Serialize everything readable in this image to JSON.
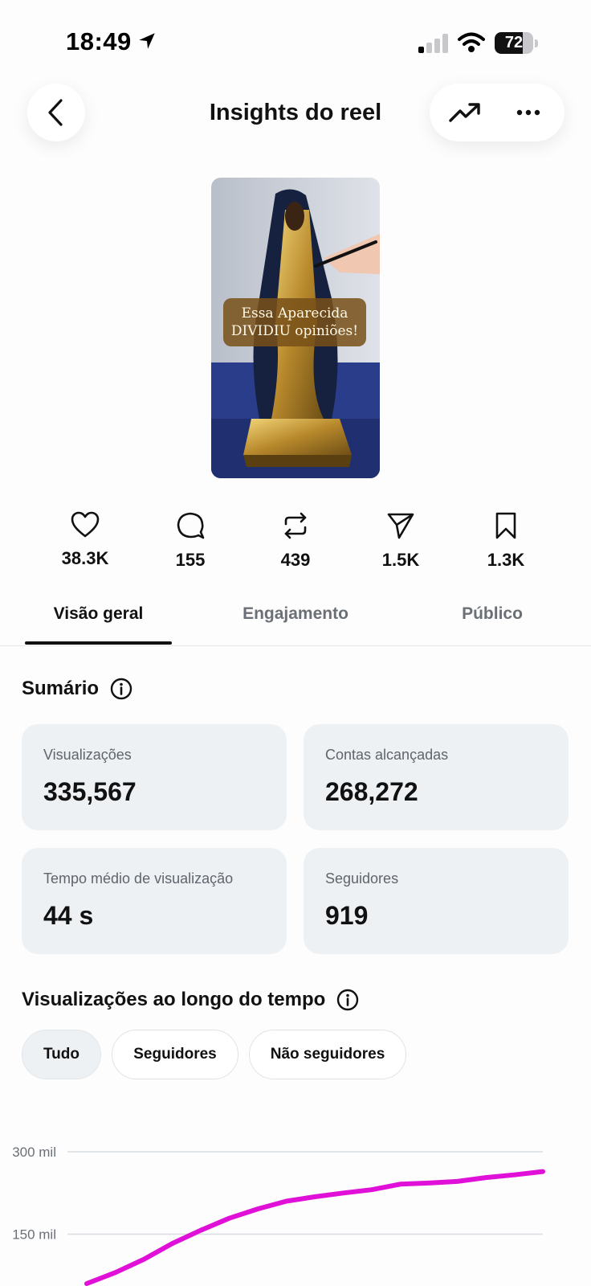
{
  "status_bar": {
    "time": "18:49",
    "battery": "72"
  },
  "header": {
    "title": "Insights do reel"
  },
  "thumbnail": {
    "caption_line1": "Essa Aparecida",
    "caption_line2": "DIVIDIU opiniões!"
  },
  "stats": {
    "likes": "38.3K",
    "comments": "155",
    "reposts": "439",
    "shares": "1.5K",
    "saves": "1.3K"
  },
  "tabs": [
    "Visão geral",
    "Engajamento",
    "Público"
  ],
  "summary": {
    "title": "Sumário",
    "cards": [
      {
        "label": "Visualizações",
        "value": "335,567"
      },
      {
        "label": "Contas alcançadas",
        "value": "268,272"
      },
      {
        "label": "Tempo médio de visualização",
        "value": "44 s"
      },
      {
        "label": "Seguidores",
        "value": "919"
      }
    ]
  },
  "views_over_time": {
    "title": "Visualizações ao longo do tempo",
    "filters": [
      "Tudo",
      "Seguidores",
      "Não seguidores"
    ],
    "selected_filter": "Tudo"
  },
  "colors": {
    "line": "#e010d8",
    "card_bg": "#eef1f4"
  },
  "chart_data": {
    "type": "line",
    "y_tick_labels": [
      "300 mil",
      "150 mil"
    ],
    "y_ticks": [
      300000,
      150000
    ],
    "ylim": [
      0,
      300000
    ],
    "series": [
      {
        "values": [
          60000,
          80000,
          104000,
          133000,
          157000,
          179000,
          196000,
          210000,
          218000,
          225000,
          231000,
          241000,
          243000,
          246000,
          253000,
          258000,
          264000
        ]
      }
    ]
  }
}
